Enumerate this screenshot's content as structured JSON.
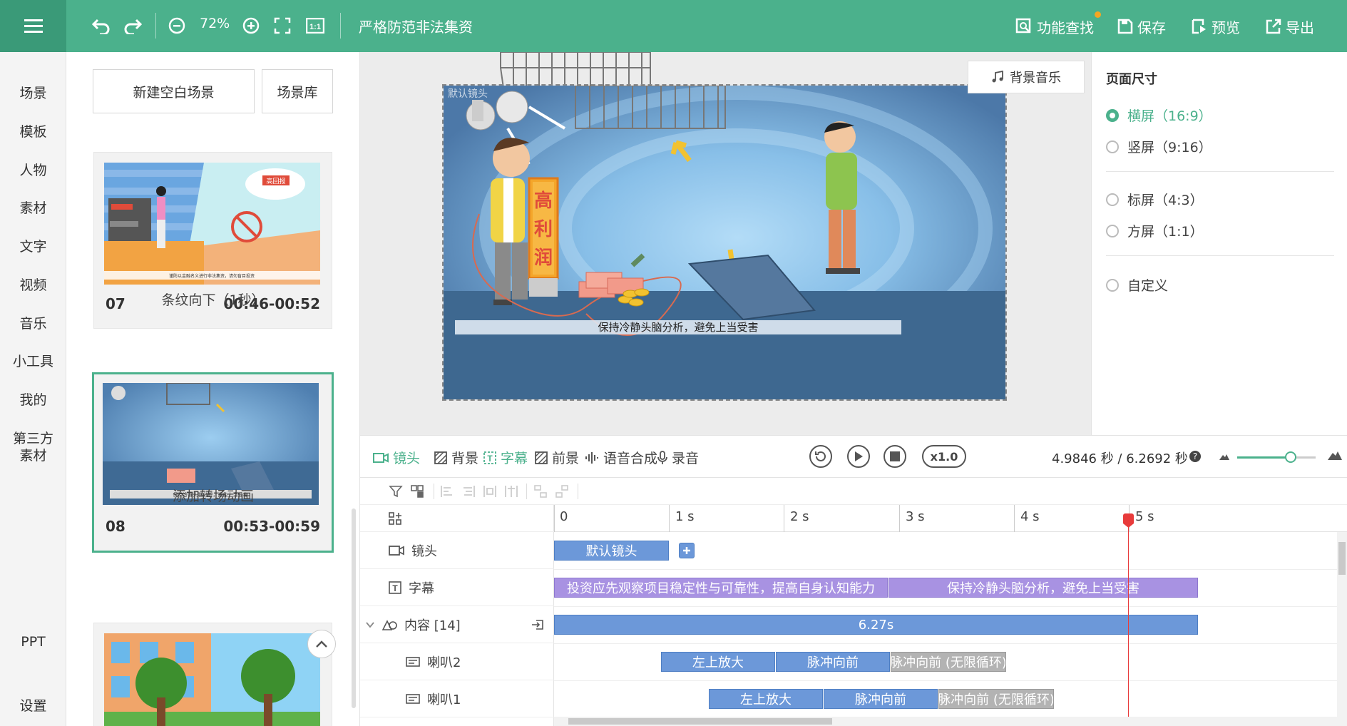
{
  "topbar": {
    "zoom": "72%",
    "project_title": "严格防范非法集资",
    "feature_search": "功能查找",
    "save": "保存",
    "preview": "预览",
    "export": "导出"
  },
  "leftnav": {
    "items": [
      "场景",
      "模板",
      "人物",
      "素材",
      "文字",
      "视频",
      "音乐",
      "小工具",
      "我的",
      "第三方素材"
    ],
    "bottom": [
      "PPT",
      "设置"
    ]
  },
  "scenes": {
    "new_blank": "新建空白场景",
    "library": "场景库",
    "cards": [
      {
        "num": "07",
        "time": "00:46-00:52",
        "transition": "条纹向下（1秒）",
        "thumb_text": "谨防以金融名义进行非法集资，请勿盲目投资"
      },
      {
        "num": "08",
        "time": "00:53-00:59",
        "transition": "添加转场动画",
        "thumb_text": "保持冷静头脑分析，避免上当受害"
      }
    ]
  },
  "canvas": {
    "bgm": "背景音乐",
    "camera_label": "默认镜头",
    "caption": "保持冷静头脑分析，避免上当受害",
    "sign": [
      "高",
      "利",
      "润"
    ],
    "thumb_badge": "高回报"
  },
  "page_size": {
    "title": "页面尺寸",
    "options": [
      {
        "label": "横屏（16:9）",
        "selected": true
      },
      {
        "label": "竖屏（9:16）",
        "selected": false
      },
      {
        "label": "标屏（4:3）",
        "selected": false
      },
      {
        "label": "方屏（1:1）",
        "selected": false
      },
      {
        "label": "自定义",
        "selected": false
      }
    ]
  },
  "timeline_tabs": [
    "镜头",
    "背景",
    "字幕",
    "前景",
    "语音合成",
    "录音"
  ],
  "playback": {
    "speed": "x1.0",
    "time": "4.9846 秒 / 6.2692 秒",
    "zoom_slider_fraction": 0.68
  },
  "timeline": {
    "ruler": [
      "0",
      "1 s",
      "2 s",
      "3 s",
      "4 s",
      "5 s"
    ],
    "rows": [
      {
        "label": "镜头",
        "icon": "camera-icon"
      },
      {
        "label": "字幕",
        "icon": "subtitle-icon"
      },
      {
        "label": "内容 [14]",
        "icon": "content-icon"
      },
      {
        "label": "喇叭2",
        "icon": "object-icon"
      },
      {
        "label": "喇叭1",
        "icon": "object-icon"
      }
    ],
    "bars": {
      "camera": "默认镜头",
      "subtitle1": "投资应先观察项目稳定性与可靠性，提高自身认知能力",
      "subtitle2": "保持冷静头脑分析，避免上当受害",
      "content": "6.27s",
      "horn2": [
        "左上放大",
        "脉冲向前",
        "脉冲向前 (无限循环)"
      ],
      "horn1": [
        "左上放大",
        "脉冲向前",
        "脉冲向前 (无限循环)"
      ]
    }
  }
}
